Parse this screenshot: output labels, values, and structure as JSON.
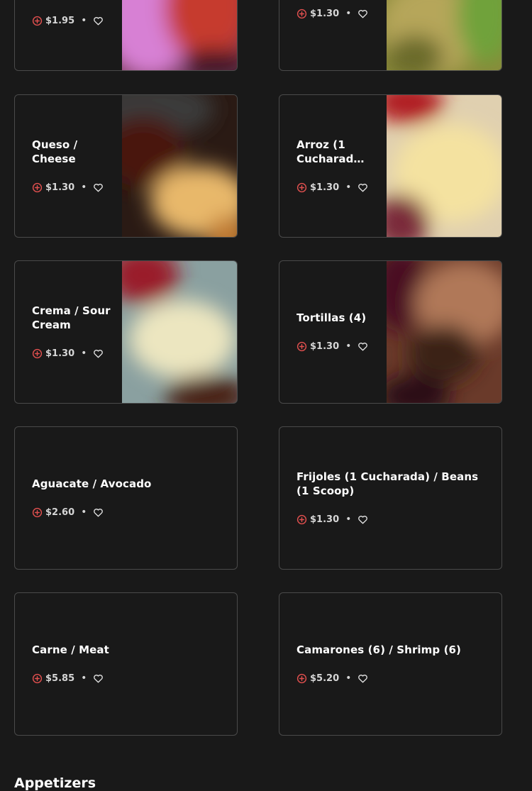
{
  "items": [
    {
      "name": "",
      "price": "$1.95"
    },
    {
      "name": "",
      "price": "$1.30"
    },
    {
      "name": "Queso / Cheese",
      "price": "$1.30"
    },
    {
      "name": "Arroz (1 Cucharad…",
      "price": "$1.30"
    },
    {
      "name": "Crema / Sour Cream",
      "price": "$1.30"
    },
    {
      "name": "Tortillas (4)",
      "price": "$1.30"
    },
    {
      "name": "Aguacate / Avocado",
      "price": "$2.60"
    },
    {
      "name": "Frijoles (1 Cucharada) / Beans (1 Scoop)",
      "price": "$1.30"
    },
    {
      "name": "Carne / Meat",
      "price": "$5.85"
    },
    {
      "name": "Camarones (6) / Shrimp (6)",
      "price": "$5.20"
    }
  ],
  "separator": "•",
  "section": {
    "title": "Appetizers"
  },
  "colors": {
    "accent": "#e2504f",
    "background": "#191919",
    "border": "#4a4a4a"
  },
  "icons": {
    "add": "plus-circle-icon",
    "favorite": "heart-icon"
  }
}
